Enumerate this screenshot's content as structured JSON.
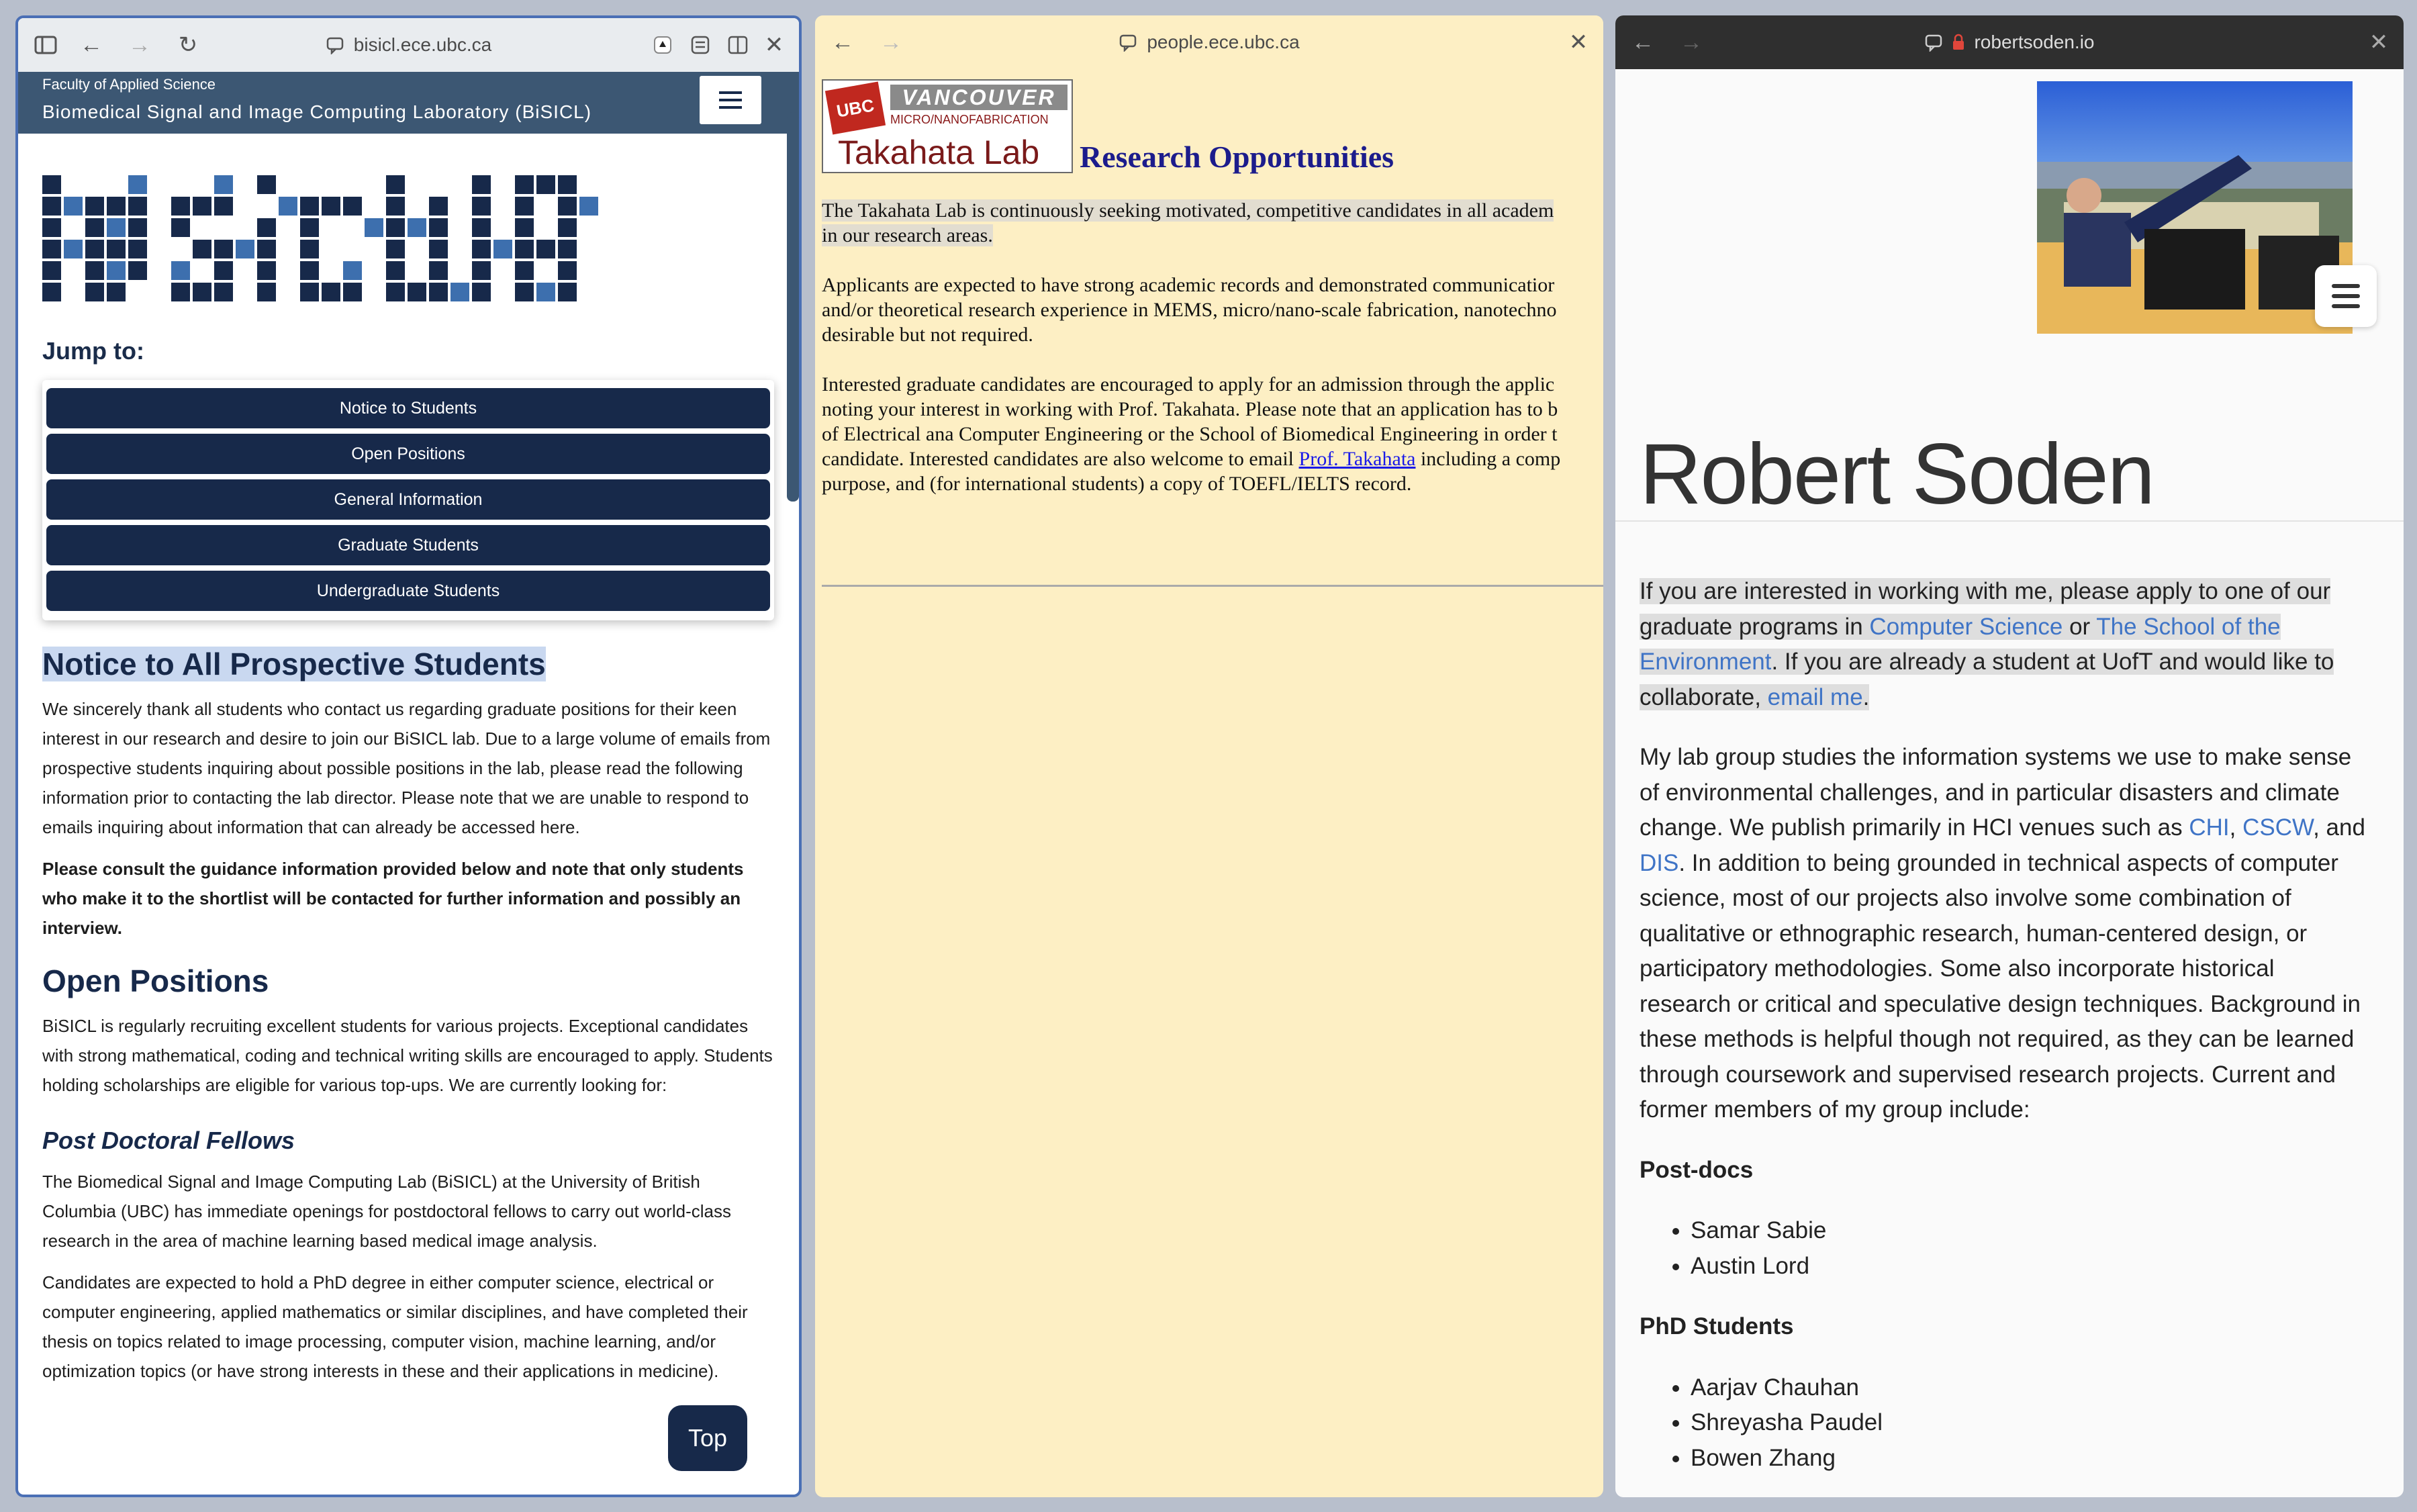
{
  "window1": {
    "url": "bisicl.ece.ubc.ca",
    "faculty": "Faculty of Applied Science",
    "lab_name": "Biomedical Signal and Image Computing Laboratory (BiSICL)",
    "logo_text": "BISICL",
    "jump_to": "Jump to:",
    "jump_links": [
      "Notice to Students",
      "Open Positions",
      "General Information",
      "Graduate Students",
      "Undergraduate Students"
    ],
    "notice_heading": "Notice to All Prospective Students",
    "notice_p1": "We sincerely thank all students who contact us regarding graduate positions for their keen interest in our research and desire to join our BiSICL lab. Due to a large volume of emails from prospective students inquiring about possible positions in the lab, please read the following information prior to contacting the lab director. Please note that we are unable to respond to emails inquiring about information that can already be accessed here.",
    "notice_p2": "Please consult the guidance information provided below and note that only students who make it to the shortlist will be contacted for further information and possibly an interview.",
    "open_heading": "Open Positions",
    "open_p1": "BiSICL is regularly recruiting excellent students for various projects. Exceptional candidates with strong mathematical, coding and technical writing skills are encouraged to apply. Students holding scholarships are eligible for various top-ups. We are currently looking for:",
    "postdoc_heading": "Post Doctoral Fellows",
    "postdoc_p1": "The Biomedical Signal and Image Computing Lab (BiSICL) at the University of British Columbia (UBC) has immediate openings for postdoctoral fellows to carry out world-class research in the area of machine learning based medical image analysis.",
    "postdoc_p2": "Candidates are expected to hold a PhD degree in either computer science, electrical or computer engineering, applied mathematics or similar disciplines, and have completed their thesis on topics related to image processing, computer vision, machine learning, and/or optimization topics (or have strong interests in these and their applications in medicine).",
    "top_button": "Top"
  },
  "window2": {
    "url": "people.ece.ubc.ca",
    "logo_ubc": "UBC",
    "logo_vancouver": "VANCOUVER",
    "logo_micro": "MICRO/NANOFABRICATION",
    "logo_lab": "Takahata Lab",
    "heading": "Research Opportunities",
    "p1_lines": [
      "The Takahata Lab is continuously seeking motivated, competitive candidates in all academ",
      "in our research areas."
    ],
    "p2_lines": [
      "Applicants are expected to have strong academic records and demonstrated communicatior",
      "and/or theoretical research experience in MEMS, micro/nano-scale fabrication, nanotechno",
      "desirable but not required."
    ],
    "p3_lines": [
      "Interested graduate candidates are encouraged to apply for an admission through the applic",
      "noting your interest in working with Prof. Takahata. Please note that an application has to b",
      "of Electrical ana Computer Engineering or the School of Biomedical Engineering in order t"
    ],
    "p3_line4_pre": "candidate. Interested candidates are also welcome to email ",
    "p3_link": "Prof. Takahata",
    "p3_line4_post": " including a comp",
    "p3_line5": "purpose, and (for international students) a copy of TOEFL/IELTS record."
  },
  "window3": {
    "url": "robertsoden.io",
    "name": "Robert Soden",
    "p1": {
      "t1": "If you are interested in working with me, please apply to one of our graduate programs in ",
      "link1": "Computer Science",
      "t2": " or ",
      "link2": "The School of the Environment",
      "t3": ". If you are already a student at UofT and would like to collaborate, ",
      "link3": "email me",
      "t4": "."
    },
    "p2": {
      "t1": "My lab group studies the information systems we use to make sense of environmental challenges, and in particular disasters and climate change. We publish primarily in HCI venues such as ",
      "link1": "CHI",
      "t2": ", ",
      "link2": "CSCW",
      "t3": ", and ",
      "link3": "DIS",
      "t4": ". In addition to being grounded in technical aspects of computer science, most of our projects also involve some combination of qualitative or ethnographic research, human-centered design, or participatory methodologies. Some also incorporate historical research or critical and speculative design techniques. Background in these methods is helpful though not required, as they can be learned through coursework and supervised research projects. Current and former members of my group include:"
    },
    "postdocs_heading": "Post-docs",
    "postdocs": [
      "Samar Sabie",
      "Austin Lord"
    ],
    "phd_heading": "PhD Students",
    "phd": [
      "Aarjav Chauhan",
      "Shreyasha Paudel",
      "Bowen Zhang"
    ]
  }
}
